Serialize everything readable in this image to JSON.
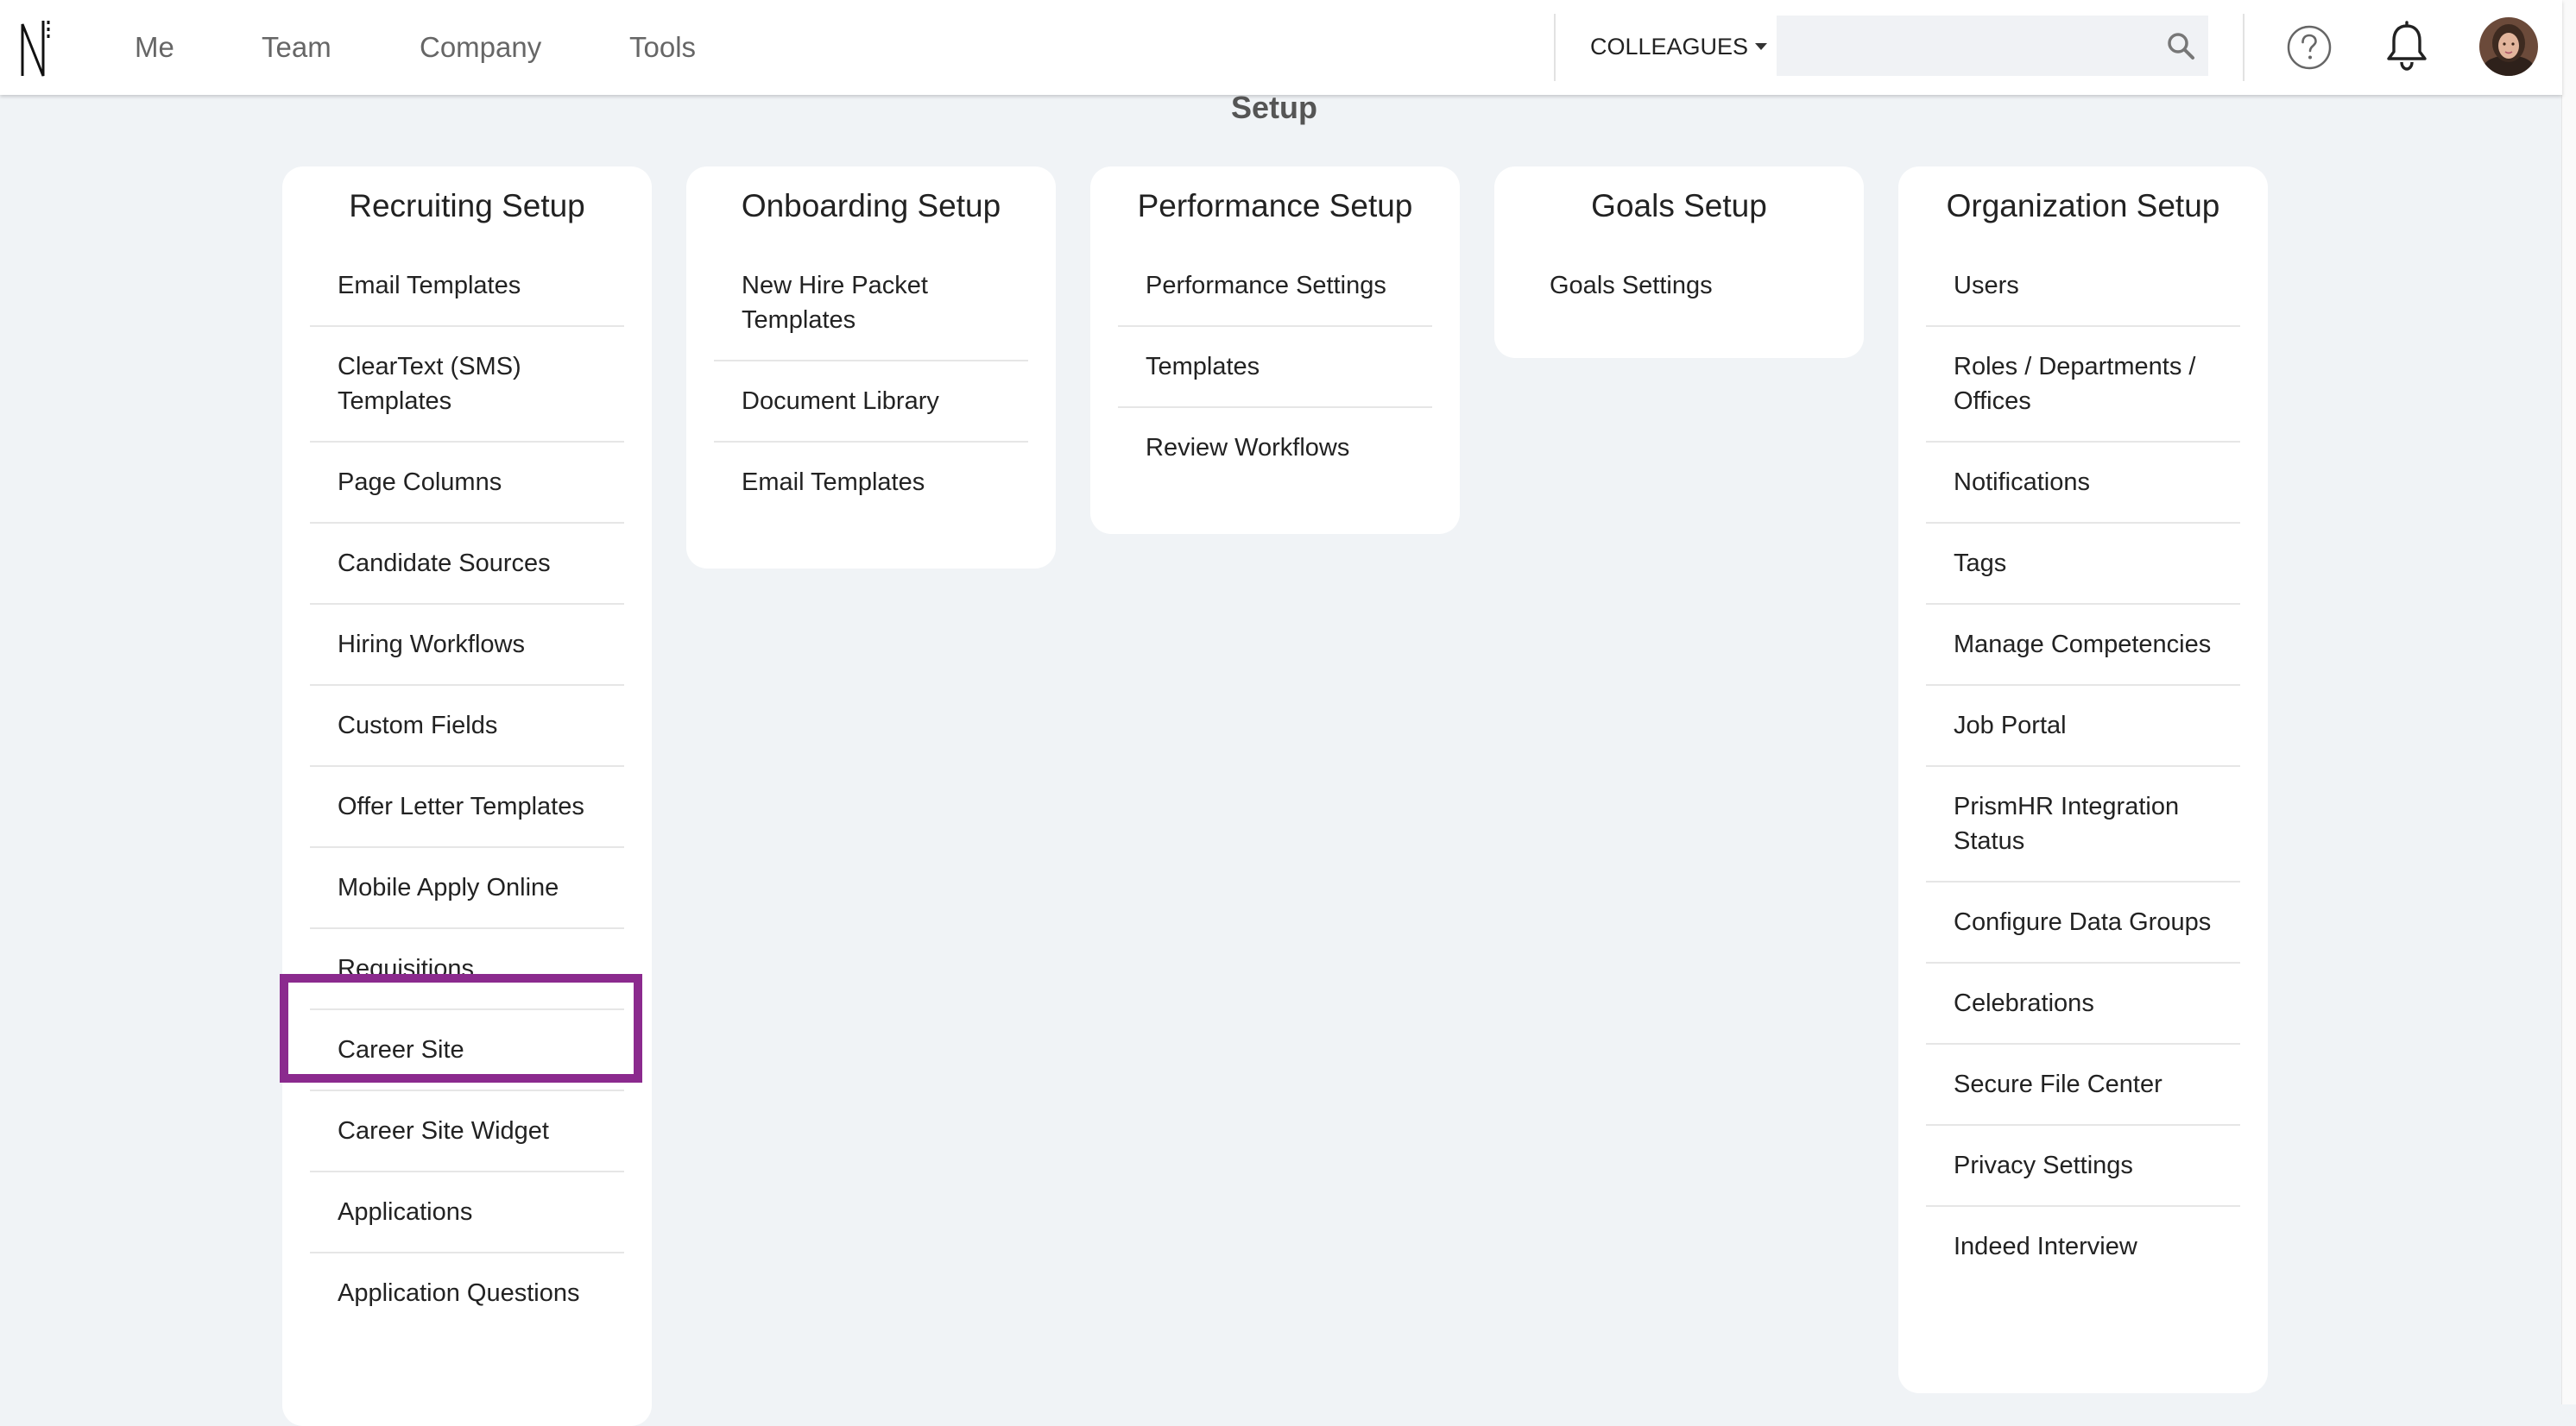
{
  "nav": {
    "items": [
      {
        "label": "Me"
      },
      {
        "label": "Team"
      },
      {
        "label": "Company"
      },
      {
        "label": "Tools"
      }
    ],
    "colleagues_label": "COLLEAGUES",
    "search": {
      "value": "",
      "placeholder": ""
    }
  },
  "page": {
    "title": "Setup"
  },
  "cards": {
    "recruiting": {
      "title": "Recruiting Setup",
      "items": [
        "Email Templates",
        "ClearText (SMS) Templates",
        "Page Columns",
        "Candidate Sources",
        "Hiring Workflows",
        "Custom Fields",
        "Offer Letter Templates",
        "Mobile Apply Online",
        "Requisitions",
        "Career Site",
        "Career Site Widget",
        "Applications",
        "Application Questions"
      ]
    },
    "onboarding": {
      "title": "Onboarding Setup",
      "items": [
        "New Hire Packet Templates",
        "Document Library",
        "Email Templates"
      ]
    },
    "performance": {
      "title": "Performance Setup",
      "items": [
        "Performance Settings",
        "Templates",
        "Review Workflows"
      ]
    },
    "goals": {
      "title": "Goals Setup",
      "items": [
        "Goals Settings"
      ]
    },
    "organization": {
      "title": "Organization Setup",
      "items": [
        "Users",
        "Roles / Departments / Offices",
        "Notifications",
        "Tags",
        "Manage Competencies",
        "Job Portal",
        "PrismHR Integration Status",
        "Configure Data Groups",
        "Celebrations",
        "Secure File Center",
        "Privacy Settings",
        "Indeed Interview"
      ]
    }
  },
  "highlight": {
    "item": "Requisitions",
    "color": "#8b2a8e"
  }
}
